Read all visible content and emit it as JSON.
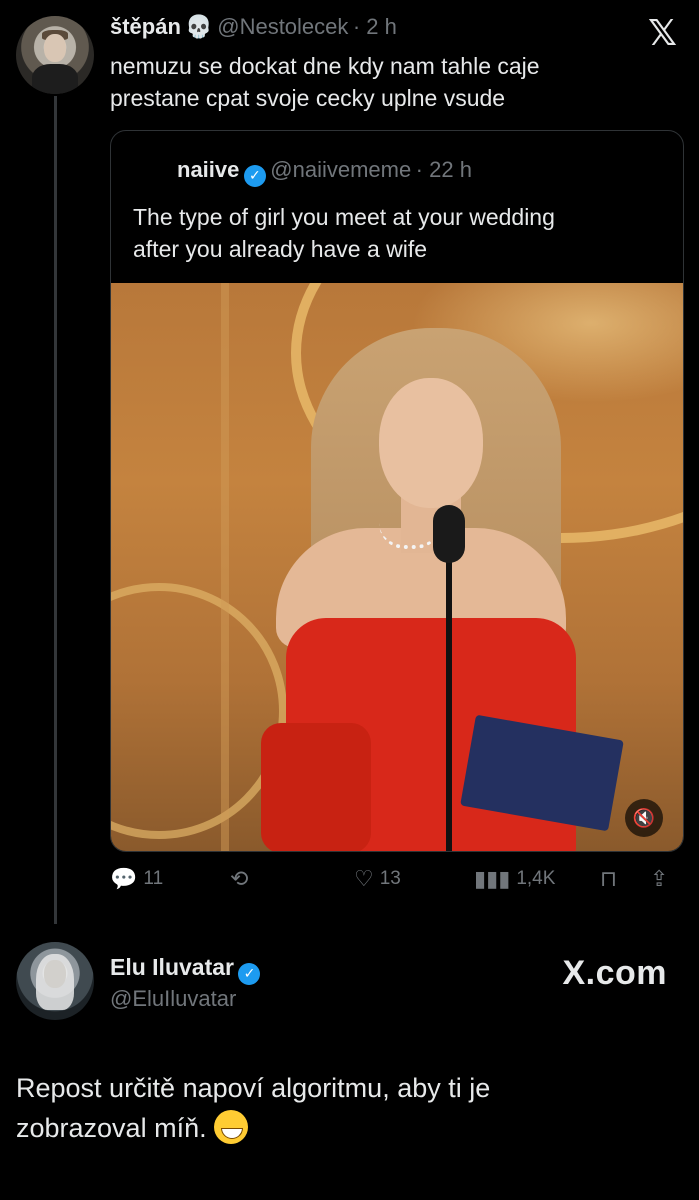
{
  "top_tweet": {
    "name": "štěpán",
    "name_emoji": "💀",
    "handle": "@Nestolecek",
    "time": "· 2 h",
    "text_line1": "nemuzu se dockat dne kdy nam tahle caje",
    "text_line2": "prestane cpat svoje cecky uplne vsude"
  },
  "quote": {
    "name": "naiive",
    "handle": "@naiivememe",
    "time": "· 22 h",
    "text_line1": "The type of girl you meet at your wedding",
    "text_line2": "after you already have a wife"
  },
  "actions": {
    "reply_count": "11",
    "like_count": "13",
    "views_count": "1,4K"
  },
  "bottom_tweet": {
    "name": "Elu Iluvatar",
    "handle": "@EluIluvatar",
    "site": "X.com",
    "text_line1": "Repost určitě napoví algoritmu, aby ti je",
    "text_line2": "zobrazoval míň."
  },
  "icons": [
    "x-logo-icon",
    "verified-icon",
    "reply-icon",
    "repost-icon",
    "like-icon",
    "views-icon",
    "bookmark-icon",
    "share-icon",
    "mute-icon"
  ],
  "colors": {
    "background": "#000000",
    "text": "#e7e9ea",
    "muted": "#71767b",
    "verified": "#1d9bf0",
    "border": "#2f3336"
  }
}
